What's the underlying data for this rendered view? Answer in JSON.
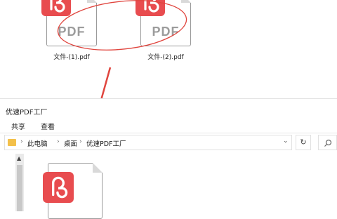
{
  "desktop_files": [
    {
      "name": "文件-(1).pdf",
      "icon_text": "PDF"
    },
    {
      "name": "文件-(2).pdf",
      "icon_text": "PDF"
    }
  ],
  "window": {
    "title": "优速PDF工厂",
    "ribbon_tabs": [
      "共享",
      "查看"
    ],
    "breadcrumb": [
      "此电脑",
      "桌面",
      "优速PDF工厂"
    ],
    "refresh_icon": "refresh-icon",
    "search_icon": "search-icon"
  },
  "colors": {
    "pdf_red": "#e84c4f",
    "annotation_red": "#e0453e",
    "folder": "#f3c04a"
  }
}
